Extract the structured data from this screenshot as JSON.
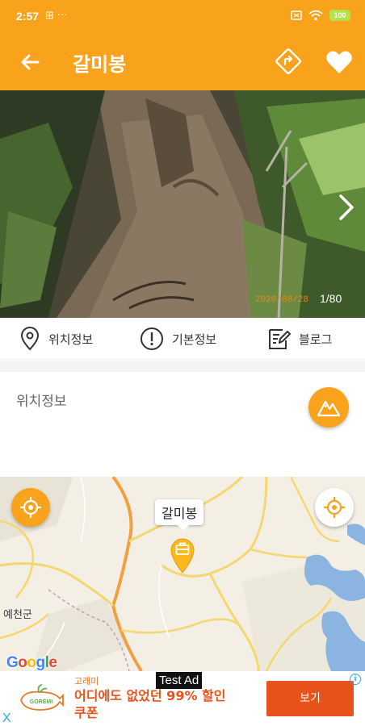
{
  "status_bar": {
    "time": "2:57",
    "left_icons": "⊞ ···",
    "battery": "100"
  },
  "toolbar": {
    "title": "갈미봉"
  },
  "photo": {
    "counter": "1/80",
    "date_stamp": "2020/08/28"
  },
  "tabs": [
    {
      "label": "위치정보",
      "icon": "location-pin-icon"
    },
    {
      "label": "기본정보",
      "icon": "info-icon"
    },
    {
      "label": "블로그",
      "icon": "blog-edit-icon"
    }
  ],
  "location": {
    "title": "위치정보"
  },
  "map": {
    "callout": "갈미봉",
    "town": "예천군",
    "google": [
      "G",
      "o",
      "o",
      "g",
      "l",
      "e"
    ]
  },
  "ad": {
    "label": "Test Ad",
    "brand": "고래미",
    "headline": "어디에도 없었던 99% 할인 쿠폰",
    "button": "보기",
    "logo_text": "GOREMI",
    "info": "i",
    "close": "X"
  },
  "colors": {
    "accent": "#f9a21b",
    "ad_button": "#e8531c",
    "map_road_orange": "#f0a040",
    "map_road_yellow": "#f5d76e",
    "map_water": "#8cb4e0"
  }
}
